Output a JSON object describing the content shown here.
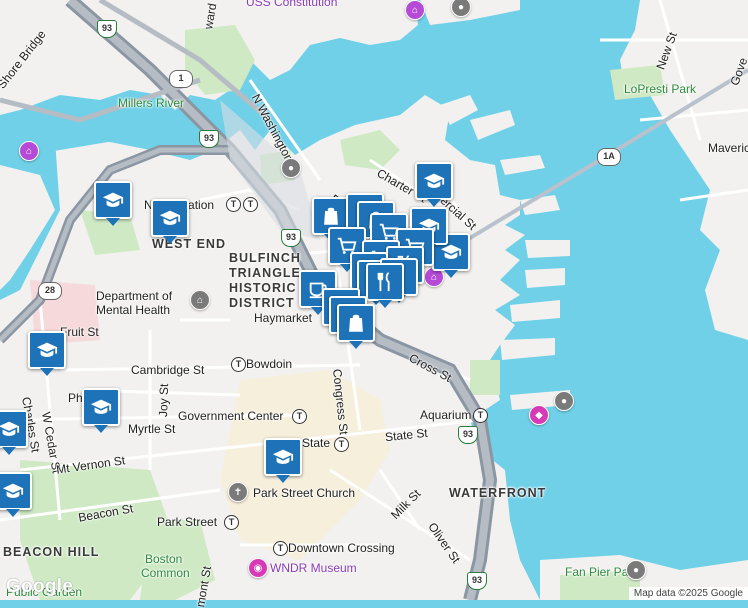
{
  "map": {
    "water_color": "#6fd0e8",
    "land_color": "#f2f1ef",
    "park_color": "#cfe9c4",
    "highway_color": "#9aa2ad",
    "marker_color": "#1e73b8"
  },
  "labels": {
    "uss_constitution": "USS Constitution",
    "ward_st": "ward St",
    "shore_bridge": "Shore Bridge",
    "millers_river": "Millers River",
    "n_washington_st": "N Washington St",
    "north_station": "North Station",
    "west_end": "WEST END",
    "bulfinch": "BULFINCH",
    "triangle": "TRIANGLE",
    "historic": "HISTORIC",
    "district": "DISTRICT",
    "dept_mental_health_1": "Department of",
    "dept_mental_health_2": "Mental Health",
    "haymarket": "Haymarket",
    "fruit_st": "Fruit St",
    "cambridge_st": "Cambridge St",
    "bowdoin": "Bowdoin",
    "joy_st": "Joy St",
    "charles_st": "Charles St",
    "w_cedar_st": "W Cedar St",
    "myrtle_st": "Myrtle St",
    "ph": "Ph",
    "government_center": "Government Center",
    "congress_st": "Congress St",
    "state_st_1": "State",
    "state_st_2": "State St",
    "mt_vernon_st": "Mt Vernon St",
    "park_street_church": "Park Street Church",
    "beacon_st": "Beacon St",
    "park_street": "Park Street",
    "beacon_hill": "BEACON HILL",
    "boston_common_1": "Boston",
    "boston_common_2": "Common",
    "downtown_crossing": "Downtown Crossing",
    "wndr_museum": "WNDR Museum",
    "public_garden": "Public Garden",
    "tremont": "mont St",
    "milk_st": "Milk St",
    "oliver_st": "Oliver St",
    "waterfront": "WATERFRONT",
    "aquarium": "Aquarium",
    "cross_st": "Cross St",
    "charter_st": "Charter St",
    "commercial_st": "Commercial St",
    "pr": "Pr",
    "lopresti_park": "LoPresti Park",
    "maveric": "Maveric",
    "new_st": "New St",
    "gove": "Gove",
    "fan_pier_park": "Fan Pier Park"
  },
  "shields": {
    "i93": "93",
    "us1": "1",
    "r28": "28",
    "r1a": "1A"
  },
  "google": "Google",
  "attribution": "Map data ©2025 Google"
}
